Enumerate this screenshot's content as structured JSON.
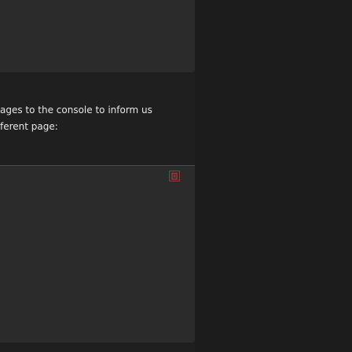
{
  "article": {
    "paragraph_lines": [
      "ages to the console to inform us",
      "ferent page:"
    ]
  },
  "code_block": {
    "copy_icon": "copy-icon",
    "accent_color": "#c0392b"
  }
}
